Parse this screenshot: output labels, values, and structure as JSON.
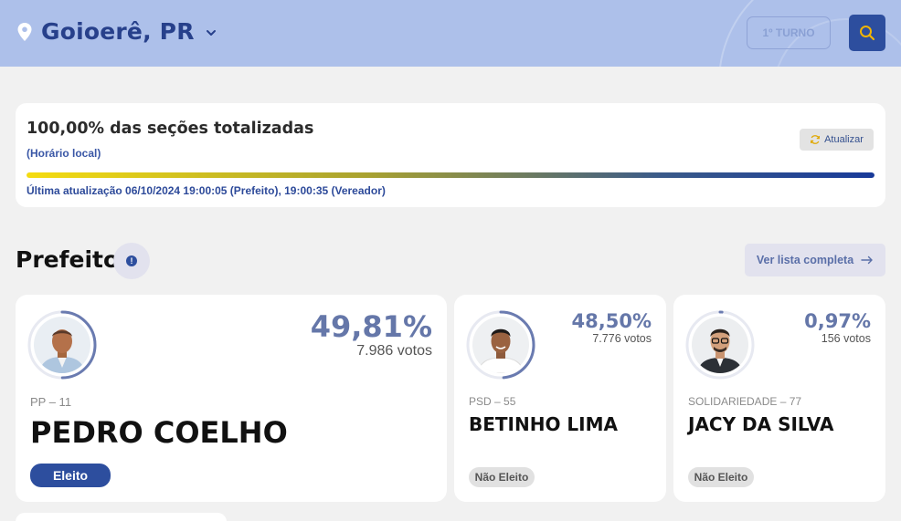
{
  "header": {
    "city": "Goioerê, PR",
    "turno_label": "1º TURNO",
    "colors": {
      "bar": "#adc0ea",
      "brand": "#2d4e9e",
      "accent": "#f2b500"
    },
    "icons": {
      "location": "location-pin-icon",
      "dropdown": "chevron-down-icon",
      "search": "search-icon"
    }
  },
  "status": {
    "title": "100,00% das seções totalizadas",
    "subtitle": "(Horário local)",
    "refresh_label": "Atualizar",
    "progress_fraction": 1.0,
    "last_update": "Última atualização 06/10/2024 19:00:05 (Prefeito), 19:00:35 (Vereador)"
  },
  "section": {
    "title": "Prefeito",
    "info_glyph": "!",
    "see_all_label": "Ver lista completa"
  },
  "candidates": [
    {
      "name": "PEDRO COELHO",
      "party": "PP – 11",
      "percent": "49,81%",
      "percent_value": 49.81,
      "votes": "7.986 votos",
      "status": "Eleito",
      "elected": true
    },
    {
      "name": "BETINHO LIMA",
      "party": "PSD – 55",
      "percent": "48,50%",
      "percent_value": 48.5,
      "votes": "7.776 votos",
      "status": "Não Eleito",
      "elected": false
    },
    {
      "name": "JACY DA SILVA",
      "party": "SOLIDARIEDADE – 77",
      "percent": "0,97%",
      "percent_value": 0.97,
      "votes": "156 votos",
      "status": "Não Eleito",
      "elected": false
    }
  ]
}
